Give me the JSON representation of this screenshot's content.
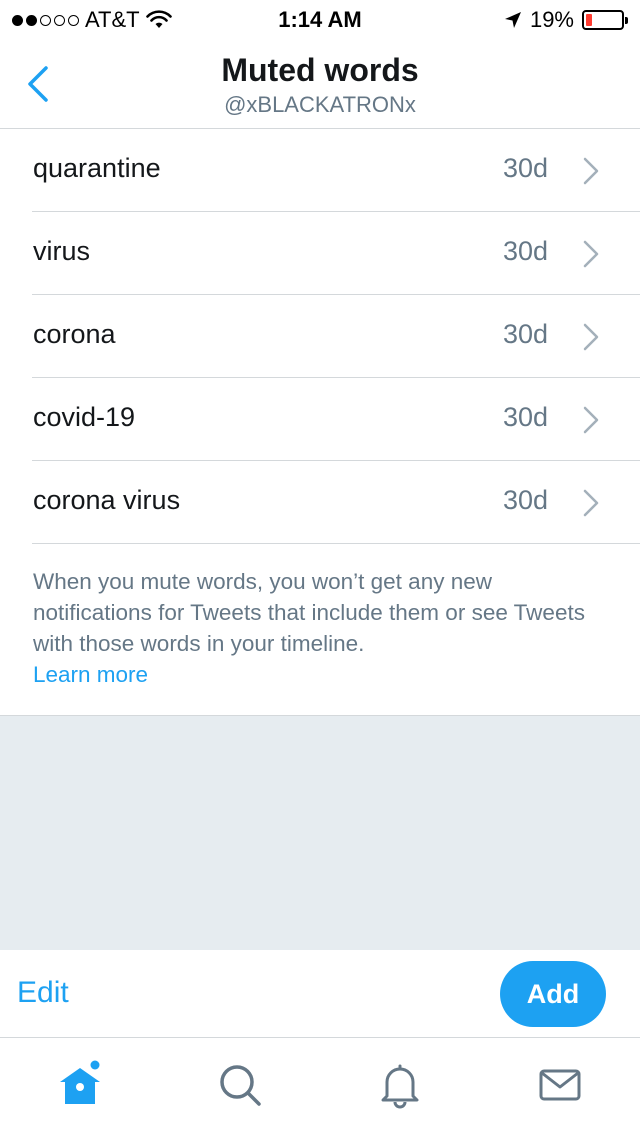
{
  "status_bar": {
    "carrier": "AT&T",
    "time": "1:14 AM",
    "battery_percent": "19%",
    "battery_level": 0.19,
    "signal_bars_filled": 2,
    "signal_bars_total": 5
  },
  "header": {
    "title": "Muted words",
    "subtitle": "@xBLACKATRONx",
    "back_icon": "chevron-left-icon"
  },
  "muted_words": [
    {
      "word": "quarantine",
      "duration": "30d"
    },
    {
      "word": "virus",
      "duration": "30d"
    },
    {
      "word": "corona",
      "duration": "30d"
    },
    {
      "word": "covid-19",
      "duration": "30d"
    },
    {
      "word": "corona virus",
      "duration": "30d"
    }
  ],
  "info": {
    "text": "When you mute words, you won’t get any new notifications for Tweets that include them or see Tweets with those words in your timeline.",
    "link_label": "Learn more"
  },
  "actions": {
    "edit_label": "Edit",
    "add_label": "Add"
  },
  "tab_bar": {
    "tabs": [
      {
        "icon": "home-icon",
        "active": true
      },
      {
        "icon": "search-icon",
        "active": false
      },
      {
        "icon": "notifications-icon",
        "active": false
      },
      {
        "icon": "messages-icon",
        "active": false
      }
    ]
  },
  "colors": {
    "accent": "#1da1f2",
    "secondary_text": "#657786",
    "background_gray": "#e6ecf0",
    "battery_low": "#ff3b30"
  }
}
